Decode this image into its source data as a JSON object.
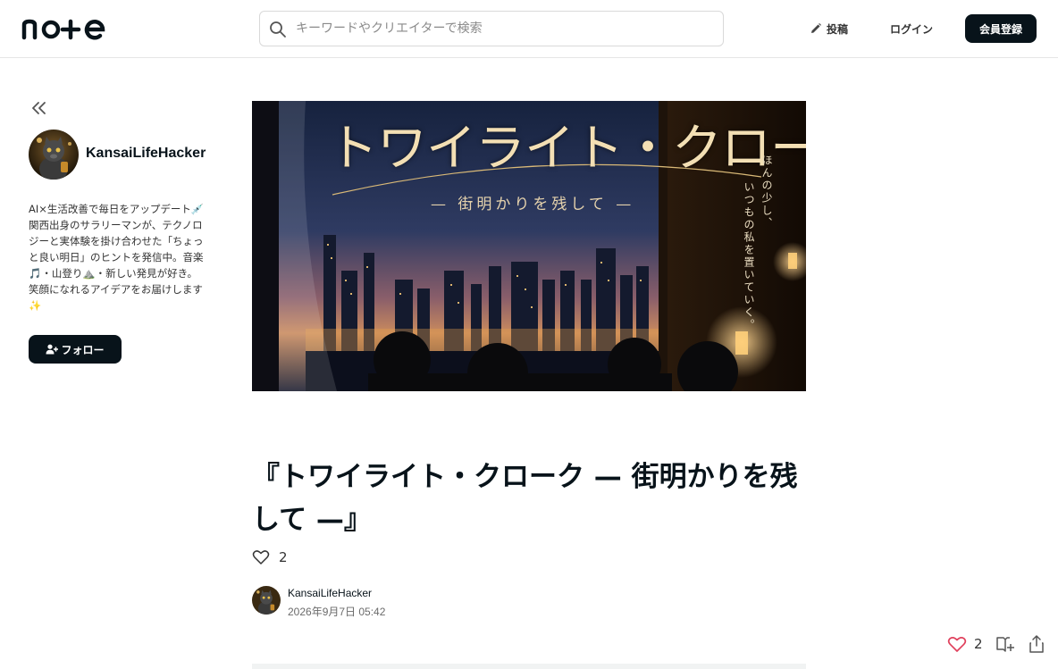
{
  "header": {
    "logo_text": "note",
    "search_placeholder": "キーワードやクリエイターで検索",
    "post_label": "投稿",
    "login_label": "ログイン",
    "signup_label": "会員登録"
  },
  "sidebar": {
    "creator_name": "KansaiLifeHacker",
    "bio": "AI×生活改善で毎日をアップデート💉 関西出身のサラリーマンが、テクノロジーと実体験を掛け合わせた「ちょっと良い明日」のヒントを発信中。音楽🎵・山登り⛰️・新しい発見が好き。笑顔になれるアイデアをお届けします✨",
    "follow_label": "フォロー"
  },
  "hero": {
    "title": "トワイライト・クローク",
    "subtitle": "— 街明かりを残して —",
    "vertical_line1": "ほんの少し、",
    "vertical_line2": "いつもの私を置いていく。"
  },
  "article": {
    "title": "『トワイライト・クローク — 街明かりを残して —』",
    "like_count": "2",
    "author_name": "KansaiLifeHacker",
    "date": "2026年9月7日 05:42"
  },
  "floating": {
    "like_count": "2"
  },
  "colors": {
    "primary": "#08131a",
    "like_red": "#e0405c"
  }
}
